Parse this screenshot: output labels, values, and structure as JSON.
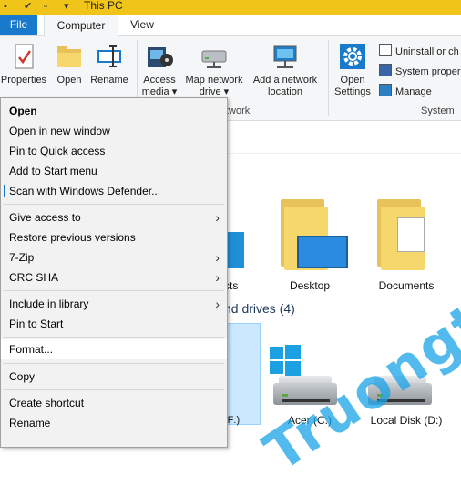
{
  "window": {
    "title": "This PC",
    "accent": "#f0c419"
  },
  "tabs": [
    {
      "label": "File"
    },
    {
      "label": "Computer"
    },
    {
      "label": "View"
    }
  ],
  "ribbon": {
    "buttons": [
      {
        "label": "Properties",
        "icon": "properties-icon"
      },
      {
        "label": "Open",
        "icon": "folder-icon"
      },
      {
        "label": "Rename",
        "icon": "rename-icon"
      },
      {
        "label": "Access media ▾",
        "icon": "media-icon"
      },
      {
        "label": "Map network drive ▾",
        "icon": "network-drive-icon"
      },
      {
        "label": "Add a network location",
        "icon": "network-location-icon"
      },
      {
        "label": "Open Settings",
        "icon": "gear-icon"
      }
    ],
    "small_buttons": [
      {
        "label": "Uninstall or ch"
      },
      {
        "label": "System proper"
      },
      {
        "label": "Manage"
      }
    ],
    "groups": [
      "twork",
      "System"
    ]
  },
  "content": {
    "folders_heading": ")",
    "drives_heading": "nd drives (4)",
    "folders": [
      {
        "label": "cts"
      },
      {
        "label": "Desktop"
      },
      {
        "label": "Documents"
      }
    ],
    "drives": [
      {
        "label": "(F:)"
      },
      {
        "label": "Acer (C:)"
      },
      {
        "label": "Local Disk (D:)"
      }
    ]
  },
  "context_menu": {
    "items": [
      {
        "label": "Open",
        "bold": true
      },
      {
        "label": "Open in new window"
      },
      {
        "label": "Pin to Quick access"
      },
      {
        "label": "Add to Start menu"
      },
      {
        "label": "Scan with Windows Defender..."
      },
      {
        "label": "Give access to",
        "submenu": true
      },
      {
        "label": "Restore previous versions"
      },
      {
        "label": "7-Zip",
        "submenu": true
      },
      {
        "label": "CRC SHA",
        "submenu": true
      },
      {
        "label": "Include in library",
        "submenu": true
      },
      {
        "label": "Pin to Start"
      },
      {
        "label": "Format..."
      },
      {
        "label": "Copy"
      },
      {
        "label": "Create shortcut"
      },
      {
        "label": "Rename"
      }
    ],
    "submenu_arrow": "›"
  },
  "watermark": {
    "text": "Truongtin.top"
  }
}
